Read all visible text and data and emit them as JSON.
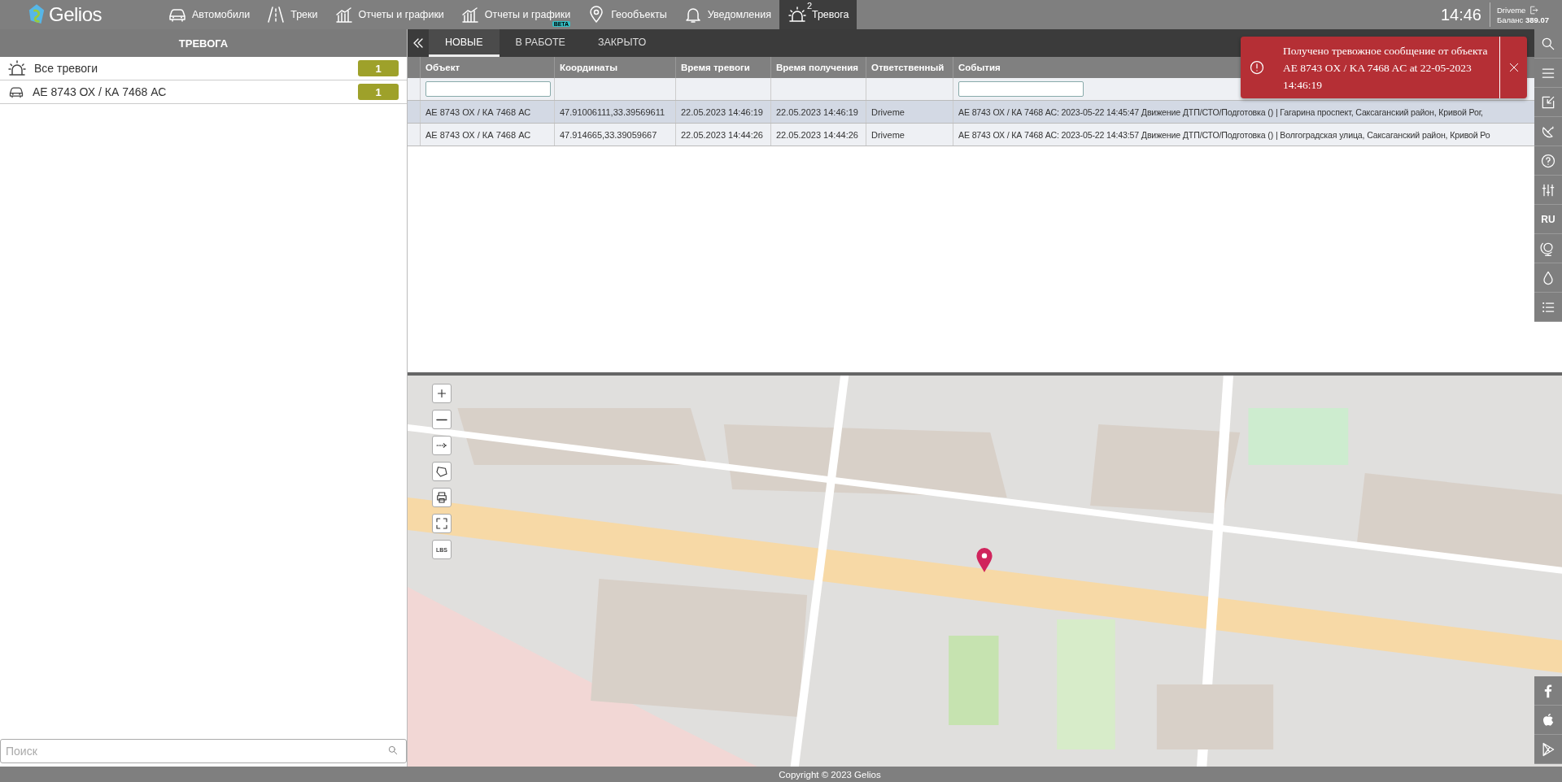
{
  "top_bar": {
    "logo": "Gelios",
    "nav": [
      {
        "label": "Автомобили",
        "kind": "car",
        "selected": false
      },
      {
        "label": "Треки",
        "kind": "road",
        "selected": false
      },
      {
        "label": "Отчеты и графики",
        "kind": "chart",
        "selected": false
      },
      {
        "label": "Отчеты и графики",
        "kind": "chart",
        "selected": false,
        "badge": "BETA"
      },
      {
        "label": "Геообъекты",
        "kind": "pin",
        "selected": false
      },
      {
        "label": "Уведомления",
        "kind": "bell",
        "selected": false
      },
      {
        "label": "Тревога",
        "kind": "alarm",
        "selected": true,
        "count": "2"
      }
    ],
    "clock": "14:46",
    "user": "Driveme",
    "balance_label": "Баланс",
    "balance": "389.07"
  },
  "alarm_panel": {
    "title": "ТРЕВОГА",
    "items": [
      {
        "kind": "all",
        "label": "Все тревоги",
        "count": "1"
      },
      {
        "kind": "vehicle",
        "label": "АЕ 8743 ОХ / КА 7468 АС",
        "count": "1"
      }
    ],
    "search": {
      "placeholder": "Поиск"
    }
  },
  "tabs": [
    {
      "label": "НОВЫЕ",
      "selected": true
    },
    {
      "label": "В РАБОТЕ",
      "selected": false
    },
    {
      "label": "ЗАКРЫТО",
      "selected": false
    }
  ],
  "table": {
    "columns": [
      {
        "label": "Объект",
        "filter": true
      },
      {
        "label": "Координаты",
        "filter": false
      },
      {
        "label": "Время тревоги",
        "filter": false
      },
      {
        "label": "Время получения",
        "filter": false
      },
      {
        "label": "Ответственный",
        "filter": false
      },
      {
        "label": "События",
        "filter": true
      }
    ],
    "rows": [
      {
        "selected": true,
        "cells": [
          "АЕ 8743 ОХ / КА 7468 АС",
          "47.91006111,33.39569611",
          "22.05.2023 14:46:19",
          "22.05.2023 14:46:19",
          "Driveme",
          "АЕ 8743 ОХ / КА 7468 АС: 2023-05-22 14:45:47 Движение ДТП/СТО/Подготовка () | Гагарина проспект, Саксаганский район, Кривой Рог,"
        ]
      },
      {
        "selected": false,
        "cells": [
          "АЕ 8743 ОХ / КА 7468 АС",
          "47.914665,33.39059667",
          "22.05.2023 14:44:26",
          "22.05.2023 14:44:26",
          "Driveme",
          "АЕ 8743 ОХ / КА 7468 АС: 2023-05-22 14:43:57 Движение ДТП/СТО/Подготовка () | Волгоградская улица, Саксаганский район, Кривой Ро"
        ]
      }
    ]
  },
  "notification": {
    "kind": "error",
    "text": "Получено тревожное сообщение от объекта AE 8743 OX / KA 7468 AC at 22-05-2023 14:46:19"
  },
  "map": {
    "kind": "picture",
    "controls": [
      {
        "kind": "zoom_in"
      },
      {
        "kind": "zoom_out"
      },
      {
        "kind": "measure"
      },
      {
        "kind": "polygon"
      },
      {
        "kind": "print"
      },
      {
        "kind": "fullscreen"
      },
      {
        "kind": "lbs",
        "label": "LBS"
      }
    ]
  },
  "side_toolbar": {
    "top": [
      {
        "kind": "search"
      },
      {
        "kind": "menu"
      },
      {
        "kind": "expand"
      },
      {
        "kind": "dish"
      },
      {
        "kind": "help"
      },
      {
        "kind": "sliders"
      },
      {
        "kind": "language",
        "label": "RU"
      },
      {
        "kind": "globe"
      },
      {
        "kind": "drop"
      },
      {
        "kind": "list"
      }
    ],
    "bottom": [
      {
        "kind": "facebook"
      },
      {
        "kind": "apple"
      },
      {
        "kind": "play"
      }
    ]
  },
  "footer": "Copyright © 2023 Gelios"
}
